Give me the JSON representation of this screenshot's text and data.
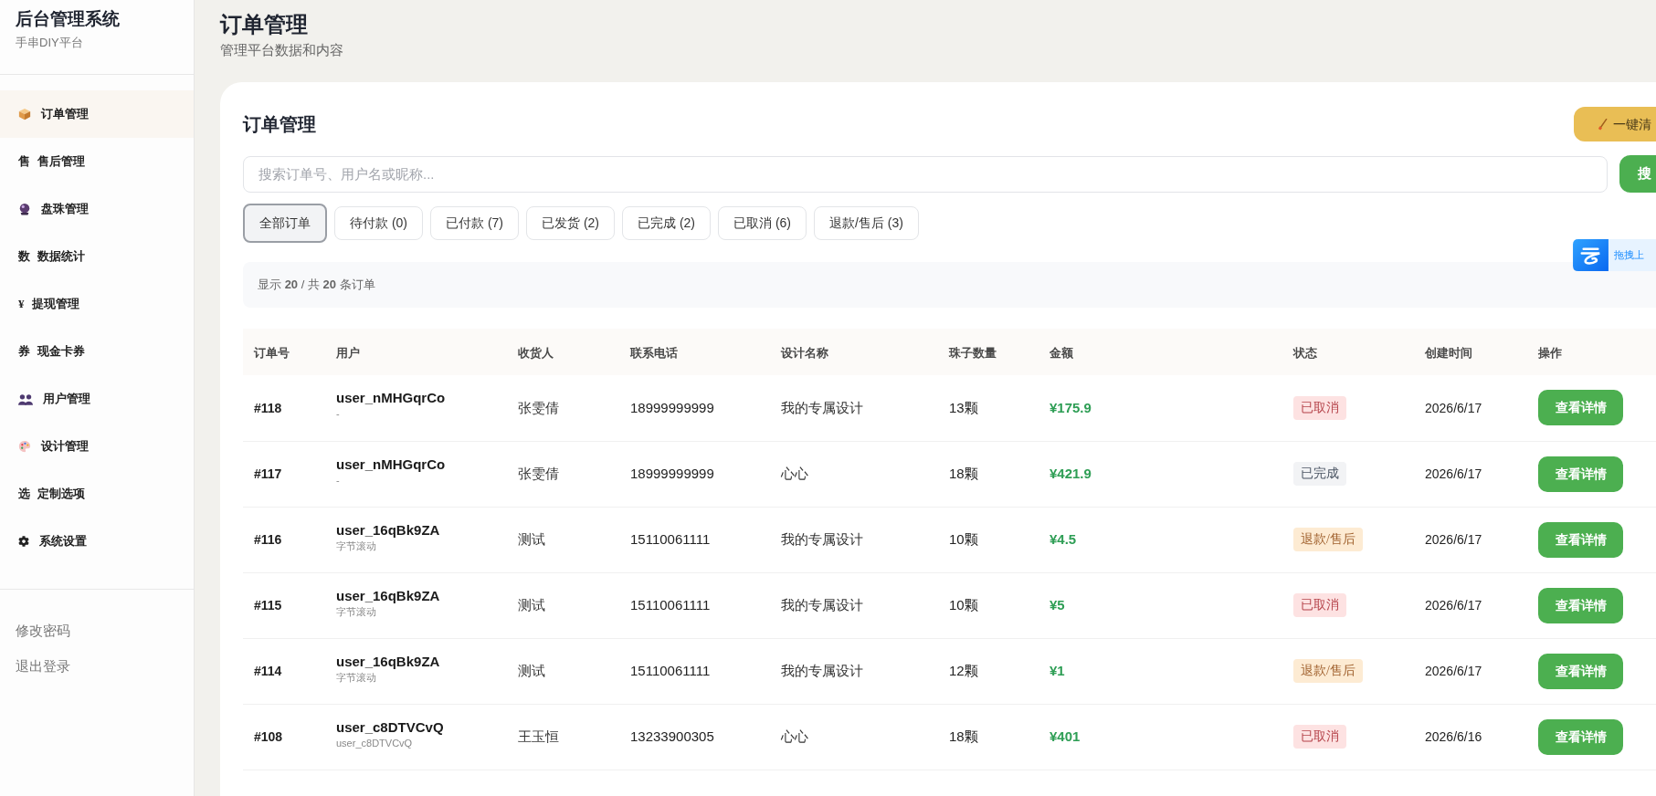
{
  "sidebar": {
    "title": "后台管理系统",
    "subtitle": "手串DIY平台",
    "items": [
      {
        "label": "订单管理",
        "kind": "icon",
        "selected": true
      },
      {
        "label": "售后管理",
        "kind": "glyph",
        "glyph": "售",
        "selected": false
      },
      {
        "label": "盘珠管理",
        "kind": "icon",
        "selected": false
      },
      {
        "label": "数据统计",
        "kind": "glyph",
        "glyph": "数",
        "selected": false
      },
      {
        "label": "提现管理",
        "kind": "glyph",
        "glyph": "¥",
        "selected": false
      },
      {
        "label": "现金卡券",
        "kind": "glyph",
        "glyph": "券",
        "selected": false
      },
      {
        "label": "用户管理",
        "kind": "icon",
        "selected": false
      },
      {
        "label": "设计管理",
        "kind": "icon",
        "selected": false
      },
      {
        "label": "定制选项",
        "kind": "glyph",
        "glyph": "选",
        "selected": false
      },
      {
        "label": "系统设置",
        "kind": "icon",
        "selected": false
      }
    ],
    "footer_links": [
      "修改密码",
      "退出登录"
    ]
  },
  "header": {
    "title": "订单管理",
    "subtitle": "管理平台数据和内容"
  },
  "panel": {
    "title": "订单管理",
    "cleanup_button": "一键清",
    "search": {
      "placeholder": "搜索订单号、用户名或昵称..."
    },
    "search_button": "搜",
    "filters": [
      {
        "label": "全部订单",
        "selected": true
      },
      {
        "label": "待付款 (0)",
        "selected": false
      },
      {
        "label": "已付款 (7)",
        "selected": false
      },
      {
        "label": "已发货 (2)",
        "selected": false
      },
      {
        "label": "已完成 (2)",
        "selected": false
      },
      {
        "label": "已取消 (6)",
        "selected": false
      },
      {
        "label": "退款/售后 (3)",
        "selected": false
      }
    ],
    "summary": "显示 **20** / 共 **20** 条订单",
    "table": {
      "columns": [
        "订单号",
        "用户",
        "收货人",
        "联系电话",
        "设计名称",
        "珠子数量",
        "金额",
        "状态",
        "创建时间",
        "操作"
      ],
      "rows": [
        {
          "order": "#118",
          "user": "user_nMHGqrCo",
          "nickname": "-",
          "receiver": "张雯倩",
          "phone": "18999999999",
          "design": "我的专属设计",
          "beads": "13颗",
          "amount": "¥175.9",
          "status": {
            "text": "已取消",
            "kind": "cancelled"
          },
          "created": "2026/6/17",
          "action": "查看详情"
        },
        {
          "order": "#117",
          "user": "user_nMHGqrCo",
          "nickname": "-",
          "receiver": "张雯倩",
          "phone": "18999999999",
          "design": "心心",
          "beads": "18颗",
          "amount": "¥421.9",
          "status": {
            "text": "已完成",
            "kind": "completed"
          },
          "created": "2026/6/17",
          "action": "查看详情"
        },
        {
          "order": "#116",
          "user": "user_16qBk9ZA",
          "nickname": "字节滚动",
          "receiver": "测试",
          "phone": "15110061111",
          "design": "我的专属设计",
          "beads": "10颗",
          "amount": "¥4.5",
          "status": {
            "text": "退款/售后",
            "kind": "refund"
          },
          "created": "2026/6/17",
          "action": "查看详情"
        },
        {
          "order": "#115",
          "user": "user_16qBk9ZA",
          "nickname": "字节滚动",
          "receiver": "测试",
          "phone": "15110061111",
          "design": "我的专属设计",
          "beads": "10颗",
          "amount": "¥5",
          "status": {
            "text": "已取消",
            "kind": "cancelled"
          },
          "created": "2026/6/17",
          "action": "查看详情"
        },
        {
          "order": "#114",
          "user": "user_16qBk9ZA",
          "nickname": "字节滚动",
          "receiver": "测试",
          "phone": "15110061111",
          "design": "我的专属设计",
          "beads": "12颗",
          "amount": "¥1",
          "status": {
            "text": "退款/售后",
            "kind": "refund"
          },
          "created": "2026/6/17",
          "action": "查看详情"
        },
        {
          "order": "#108",
          "user": "user_c8DTVCvQ",
          "nickname": "user_c8DTVCvQ",
          "receiver": "王玉恒",
          "phone": "13233900305",
          "design": "心心",
          "beads": "18颗",
          "amount": "¥401",
          "status": {
            "text": "已取消",
            "kind": "cancelled"
          },
          "created": "2026/6/16",
          "action": "查看详情"
        }
      ]
    }
  },
  "upload_widget": {
    "label": "拖拽上"
  }
}
